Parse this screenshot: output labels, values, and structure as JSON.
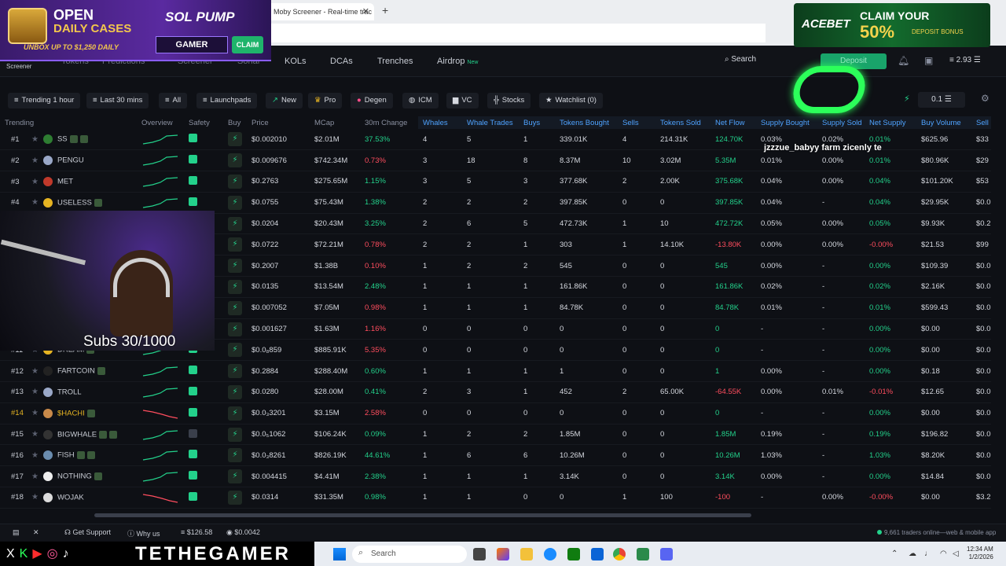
{
  "browser": {
    "tab_title": "Moby Screener - Real-time trac",
    "new_tab": "+"
  },
  "ad_left": {
    "headline1": "OPEN",
    "headline2": "DAILY CASES",
    "subline": "UNBOX UP TO $1,250 DAILY",
    "brand": "SOL PUMP",
    "code": "GAMER",
    "cta": "CLAIM"
  },
  "ad_right": {
    "brand": "ACEBET",
    "claim": "CLAIM YOUR",
    "percent": "50%",
    "bonus": "DEPOSIT BONUS"
  },
  "nav": {
    "logo_sub": "Screener",
    "items": [
      "Tokens",
      "Predictions",
      "Screener",
      "Sonar",
      "KOLs",
      "DCAs",
      "Trenches",
      "Airdrop"
    ],
    "new_badge": "New",
    "search": "Search",
    "deposit": "Deposit",
    "balance": "2.93"
  },
  "filters": {
    "trending": "Trending 1 hour",
    "timeframe": "Last 30 mins",
    "all": "All",
    "launchpads": "Launchpads",
    "new": "New",
    "pro": "Pro",
    "degen": "Degen",
    "icm": "ICM",
    "vc": "VC",
    "stocks": "Stocks",
    "watchlist": "Watchlist (0)",
    "amount": "0.1"
  },
  "table": {
    "headers": [
      "Trending",
      "Overview",
      "Safety",
      "Buy",
      "Price",
      "MCap",
      "30m Change",
      "Whales",
      "Whale Trades",
      "Buys",
      "Tokens Bought",
      "Sells",
      "Tokens Sold",
      "Net Flow",
      "Supply Bought",
      "Supply Sold",
      "Net Supply",
      "Buy Volume",
      "Sell"
    ],
    "rows": [
      {
        "idx": "#1",
        "name": "SS",
        "price": "$0.002010",
        "mcap": "$2.01M",
        "chg": "37.53%",
        "chgDir": "pos",
        "whales": "4",
        "wt": "5",
        "buys": "1",
        "tb": "339.01K",
        "sells": "4",
        "ts": "214.31K",
        "nf": "124.70K",
        "nfDir": "pos",
        "sb": "0.03%",
        "ss": "0.02%",
        "ns": "0.01%",
        "nsDir": "pos",
        "bv": "$625.96",
        "sv": "$33",
        "trend": "up",
        "av": "#2e7d32",
        "safe": "green"
      },
      {
        "idx": "#2",
        "name": "PENGU",
        "price": "$0.009676",
        "mcap": "$742.34M",
        "chg": "0.73%",
        "chgDir": "neg",
        "whales": "3",
        "wt": "18",
        "buys": "8",
        "tb": "8.37M",
        "sells": "10",
        "ts": "3.02M",
        "nf": "5.35M",
        "nfDir": "pos",
        "sb": "0.01%",
        "ss": "0.00%",
        "ns": "0.01%",
        "nsDir": "pos",
        "bv": "$80.96K",
        "sv": "$29",
        "trend": "up",
        "av": "#9aa8c8",
        "safe": "green"
      },
      {
        "idx": "#3",
        "name": "MET",
        "price": "$0.2763",
        "mcap": "$275.65M",
        "chg": "1.15%",
        "chgDir": "pos",
        "whales": "3",
        "wt": "5",
        "buys": "3",
        "tb": "377.68K",
        "sells": "2",
        "ts": "2.00K",
        "nf": "375.68K",
        "nfDir": "pos",
        "sb": "0.04%",
        "ss": "0.00%",
        "ns": "0.04%",
        "nsDir": "pos",
        "bv": "$101.20K",
        "sv": "$53",
        "trend": "up",
        "av": "#c0392b",
        "safe": "green"
      },
      {
        "idx": "#4",
        "name": "USELESS",
        "price": "$0.0755",
        "mcap": "$75.43M",
        "chg": "1.38%",
        "chgDir": "pos",
        "whales": "2",
        "wt": "2",
        "buys": "2",
        "tb": "397.85K",
        "sells": "0",
        "ts": "0",
        "nf": "397.85K",
        "nfDir": "pos",
        "sb": "0.04%",
        "ss": "-",
        "ns": "0.04%",
        "nsDir": "pos",
        "bv": "$29.95K",
        "sv": "$0.0",
        "trend": "up",
        "av": "#e6b422",
        "safe": "green"
      },
      {
        "idx": "#5",
        "name": "",
        "price": "$0.0204",
        "mcap": "$20.43M",
        "chg": "3.25%",
        "chgDir": "pos",
        "whales": "2",
        "wt": "6",
        "buys": "5",
        "tb": "472.73K",
        "sells": "1",
        "ts": "10",
        "nf": "472.72K",
        "nfDir": "pos",
        "sb": "0.05%",
        "ss": "0.00%",
        "ns": "0.05%",
        "nsDir": "pos",
        "bv": "$9.93K",
        "sv": "$0.2",
        "trend": "up",
        "av": "#555",
        "safe": "green"
      },
      {
        "idx": "#6",
        "name": "",
        "price": "$0.0722",
        "mcap": "$72.21M",
        "chg": "0.78%",
        "chgDir": "neg",
        "whales": "2",
        "wt": "2",
        "buys": "1",
        "tb": "303",
        "sells": "1",
        "ts": "14.10K",
        "nf": "-13.80K",
        "nfDir": "neg",
        "sb": "0.00%",
        "ss": "0.00%",
        "ns": "-0.00%",
        "nsDir": "neg",
        "bv": "$21.53",
        "sv": "$99",
        "trend": "up",
        "av": "#555",
        "safe": "green"
      },
      {
        "idx": "#7",
        "name": "",
        "price": "$0.2007",
        "mcap": "$1.38B",
        "chg": "0.10%",
        "chgDir": "neg",
        "whales": "1",
        "wt": "2",
        "buys": "2",
        "tb": "545",
        "sells": "0",
        "ts": "0",
        "nf": "545",
        "nfDir": "pos",
        "sb": "0.00%",
        "ss": "-",
        "ns": "0.00%",
        "nsDir": "pos",
        "bv": "$109.39",
        "sv": "$0.0",
        "trend": "up",
        "av": "#555",
        "safe": "green"
      },
      {
        "idx": "#8",
        "name": "",
        "price": "$0.0135",
        "mcap": "$13.54M",
        "chg": "2.48%",
        "chgDir": "pos",
        "whales": "1",
        "wt": "1",
        "buys": "1",
        "tb": "161.86K",
        "sells": "0",
        "ts": "0",
        "nf": "161.86K",
        "nfDir": "pos",
        "sb": "0.02%",
        "ss": "-",
        "ns": "0.02%",
        "nsDir": "pos",
        "bv": "$2.16K",
        "sv": "$0.0",
        "trend": "up",
        "av": "#555",
        "safe": "green"
      },
      {
        "idx": "#9",
        "name": "",
        "price": "$0.007052",
        "mcap": "$7.05M",
        "chg": "0.98%",
        "chgDir": "neg",
        "whales": "1",
        "wt": "1",
        "buys": "1",
        "tb": "84.78K",
        "sells": "0",
        "ts": "0",
        "nf": "84.78K",
        "nfDir": "pos",
        "sb": "0.01%",
        "ss": "-",
        "ns": "0.01%",
        "nsDir": "pos",
        "bv": "$599.43",
        "sv": "$0.0",
        "trend": "up",
        "av": "#555",
        "safe": "green"
      },
      {
        "idx": "#10",
        "name": "",
        "price": "$0.001627",
        "mcap": "$1.63M",
        "chg": "1.16%",
        "chgDir": "neg",
        "whales": "0",
        "wt": "0",
        "buys": "0",
        "tb": "0",
        "sells": "0",
        "ts": "0",
        "nf": "0",
        "nfDir": "pos",
        "sb": "-",
        "ss": "-",
        "ns": "0.00%",
        "nsDir": "pos",
        "bv": "$0.00",
        "sv": "$0.0",
        "trend": "up",
        "av": "#555",
        "safe": "green"
      },
      {
        "idx": "#11",
        "name": "DREAM",
        "price": "$0.0₈859",
        "mcap": "$885.91K",
        "chg": "5.35%",
        "chgDir": "neg",
        "whales": "0",
        "wt": "0",
        "buys": "0",
        "tb": "0",
        "sells": "0",
        "ts": "0",
        "nf": "0",
        "nfDir": "pos",
        "sb": "-",
        "ss": "-",
        "ns": "0.00%",
        "nsDir": "pos",
        "bv": "$0.00",
        "sv": "$0.0",
        "trend": "up",
        "av": "#e6b422",
        "safe": "green"
      },
      {
        "idx": "#12",
        "name": "FARTCOIN",
        "price": "$0.2884",
        "mcap": "$288.40M",
        "chg": "0.60%",
        "chgDir": "pos",
        "whales": "1",
        "wt": "1",
        "buys": "1",
        "tb": "1",
        "sells": "0",
        "ts": "0",
        "nf": "1",
        "nfDir": "pos",
        "sb": "0.00%",
        "ss": "-",
        "ns": "0.00%",
        "nsDir": "pos",
        "bv": "$0.18",
        "sv": "$0.0",
        "trend": "up",
        "av": "#222",
        "safe": "green"
      },
      {
        "idx": "#13",
        "name": "TROLL",
        "price": "$0.0280",
        "mcap": "$28.00M",
        "chg": "0.41%",
        "chgDir": "pos",
        "whales": "2",
        "wt": "3",
        "buys": "1",
        "tb": "452",
        "sells": "2",
        "ts": "65.00K",
        "nf": "-64.55K",
        "nfDir": "neg",
        "sb": "0.00%",
        "ss": "0.01%",
        "ns": "-0.01%",
        "nsDir": "neg",
        "bv": "$12.65",
        "sv": "$0.0",
        "trend": "up",
        "av": "#9aa8c8",
        "safe": "green"
      },
      {
        "idx": "#14",
        "name": "$HACHI",
        "price": "$0.0₃3201",
        "mcap": "$3.15M",
        "chg": "2.58%",
        "chgDir": "neg",
        "whales": "0",
        "wt": "0",
        "buys": "0",
        "tb": "0",
        "sells": "0",
        "ts": "0",
        "nf": "0",
        "nfDir": "pos",
        "sb": "-",
        "ss": "-",
        "ns": "0.00%",
        "nsDir": "pos",
        "bv": "$0.00",
        "sv": "$0.0",
        "trend": "down",
        "av": "#c98a4a",
        "safe": "green",
        "gold": true
      },
      {
        "idx": "#15",
        "name": "BIGWHALE",
        "price": "$0.0₅1062",
        "mcap": "$106.24K",
        "chg": "0.09%",
        "chgDir": "pos",
        "whales": "1",
        "wt": "2",
        "buys": "2",
        "tb": "1.85M",
        "sells": "0",
        "ts": "0",
        "nf": "1.85M",
        "nfDir": "pos",
        "sb": "0.19%",
        "ss": "-",
        "ns": "0.19%",
        "nsDir": "pos",
        "bv": "$196.82",
        "sv": "$0.0",
        "trend": "up",
        "av": "#333",
        "safe": "gray"
      },
      {
        "idx": "#16",
        "name": "FISH",
        "price": "$0.0₃8261",
        "mcap": "$826.19K",
        "chg": "44.61%",
        "chgDir": "pos",
        "whales": "1",
        "wt": "6",
        "buys": "6",
        "tb": "10.26M",
        "sells": "0",
        "ts": "0",
        "nf": "10.26M",
        "nfDir": "pos",
        "sb": "1.03%",
        "ss": "-",
        "ns": "1.03%",
        "nsDir": "pos",
        "bv": "$8.20K",
        "sv": "$0.0",
        "trend": "up",
        "av": "#6a8caf",
        "safe": "green"
      },
      {
        "idx": "#17",
        "name": "NOTHING",
        "price": "$0.004415",
        "mcap": "$4.41M",
        "chg": "2.38%",
        "chgDir": "pos",
        "whales": "1",
        "wt": "1",
        "buys": "1",
        "tb": "3.14K",
        "sells": "0",
        "ts": "0",
        "nf": "3.14K",
        "nfDir": "pos",
        "sb": "0.00%",
        "ss": "-",
        "ns": "0.00%",
        "nsDir": "pos",
        "bv": "$14.84",
        "sv": "$0.0",
        "trend": "up",
        "av": "#eeeeee",
        "safe": "green"
      },
      {
        "idx": "#18",
        "name": "WOJAK",
        "price": "$0.0314",
        "mcap": "$31.35M",
        "chg": "0.98%",
        "chgDir": "pos",
        "whales": "1",
        "wt": "1",
        "buys": "0",
        "tb": "0",
        "sells": "1",
        "ts": "100",
        "nf": "-100",
        "nfDir": "neg",
        "sb": "-",
        "ss": "0.00%",
        "ns": "-0.00%",
        "nsDir": "neg",
        "bv": "$0.00",
        "sv": "$3.2",
        "trend": "down",
        "av": "#dcdcdc",
        "safe": "green"
      }
    ]
  },
  "overlay": {
    "subs": "Subs 30/1000",
    "chat_text": "jzzzue_babyy farm zicenly te"
  },
  "statusbar": {
    "support": "Get Support",
    "why": "Why us",
    "sol_price": "$126.58",
    "token_price": "$0.0042",
    "online": "9,661 traders online—web & mobile app"
  },
  "stream": {
    "handle": "TETHEGAMER"
  },
  "taskbar": {
    "search": "Search",
    "time": "12:34 AM",
    "date": "1/2/2026"
  },
  "colors": {
    "positive": "#23d18b",
    "negative": "#ff4d5e",
    "accent": "#4fa3ff"
  }
}
